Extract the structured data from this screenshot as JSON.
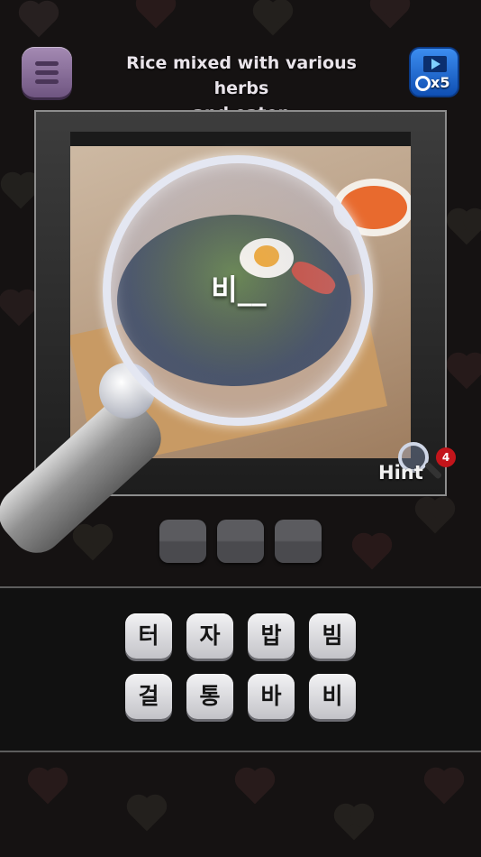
{
  "clue": {
    "line1": "Rice mixed with various herbs",
    "line2": "and eaten"
  },
  "icons": {
    "menu": "menu-icon",
    "video_reward": "video-play-icon",
    "hint": "magnifier-icon"
  },
  "video_reward": {
    "label": "x5"
  },
  "magnifier": {
    "revealed_text": "비__"
  },
  "hint": {
    "label": "Hint",
    "count": "4"
  },
  "answer_slots": [
    "",
    "",
    ""
  ],
  "letters": {
    "row1": [
      "터",
      "자",
      "밥",
      "빔"
    ],
    "row2": [
      "걸",
      "통",
      "바",
      "비"
    ]
  },
  "colors": {
    "menu_button": "#8c6f9e",
    "video_button": "#1f6fd6",
    "hint_badge": "#c3151b",
    "key_face": "#e2e2e5"
  }
}
